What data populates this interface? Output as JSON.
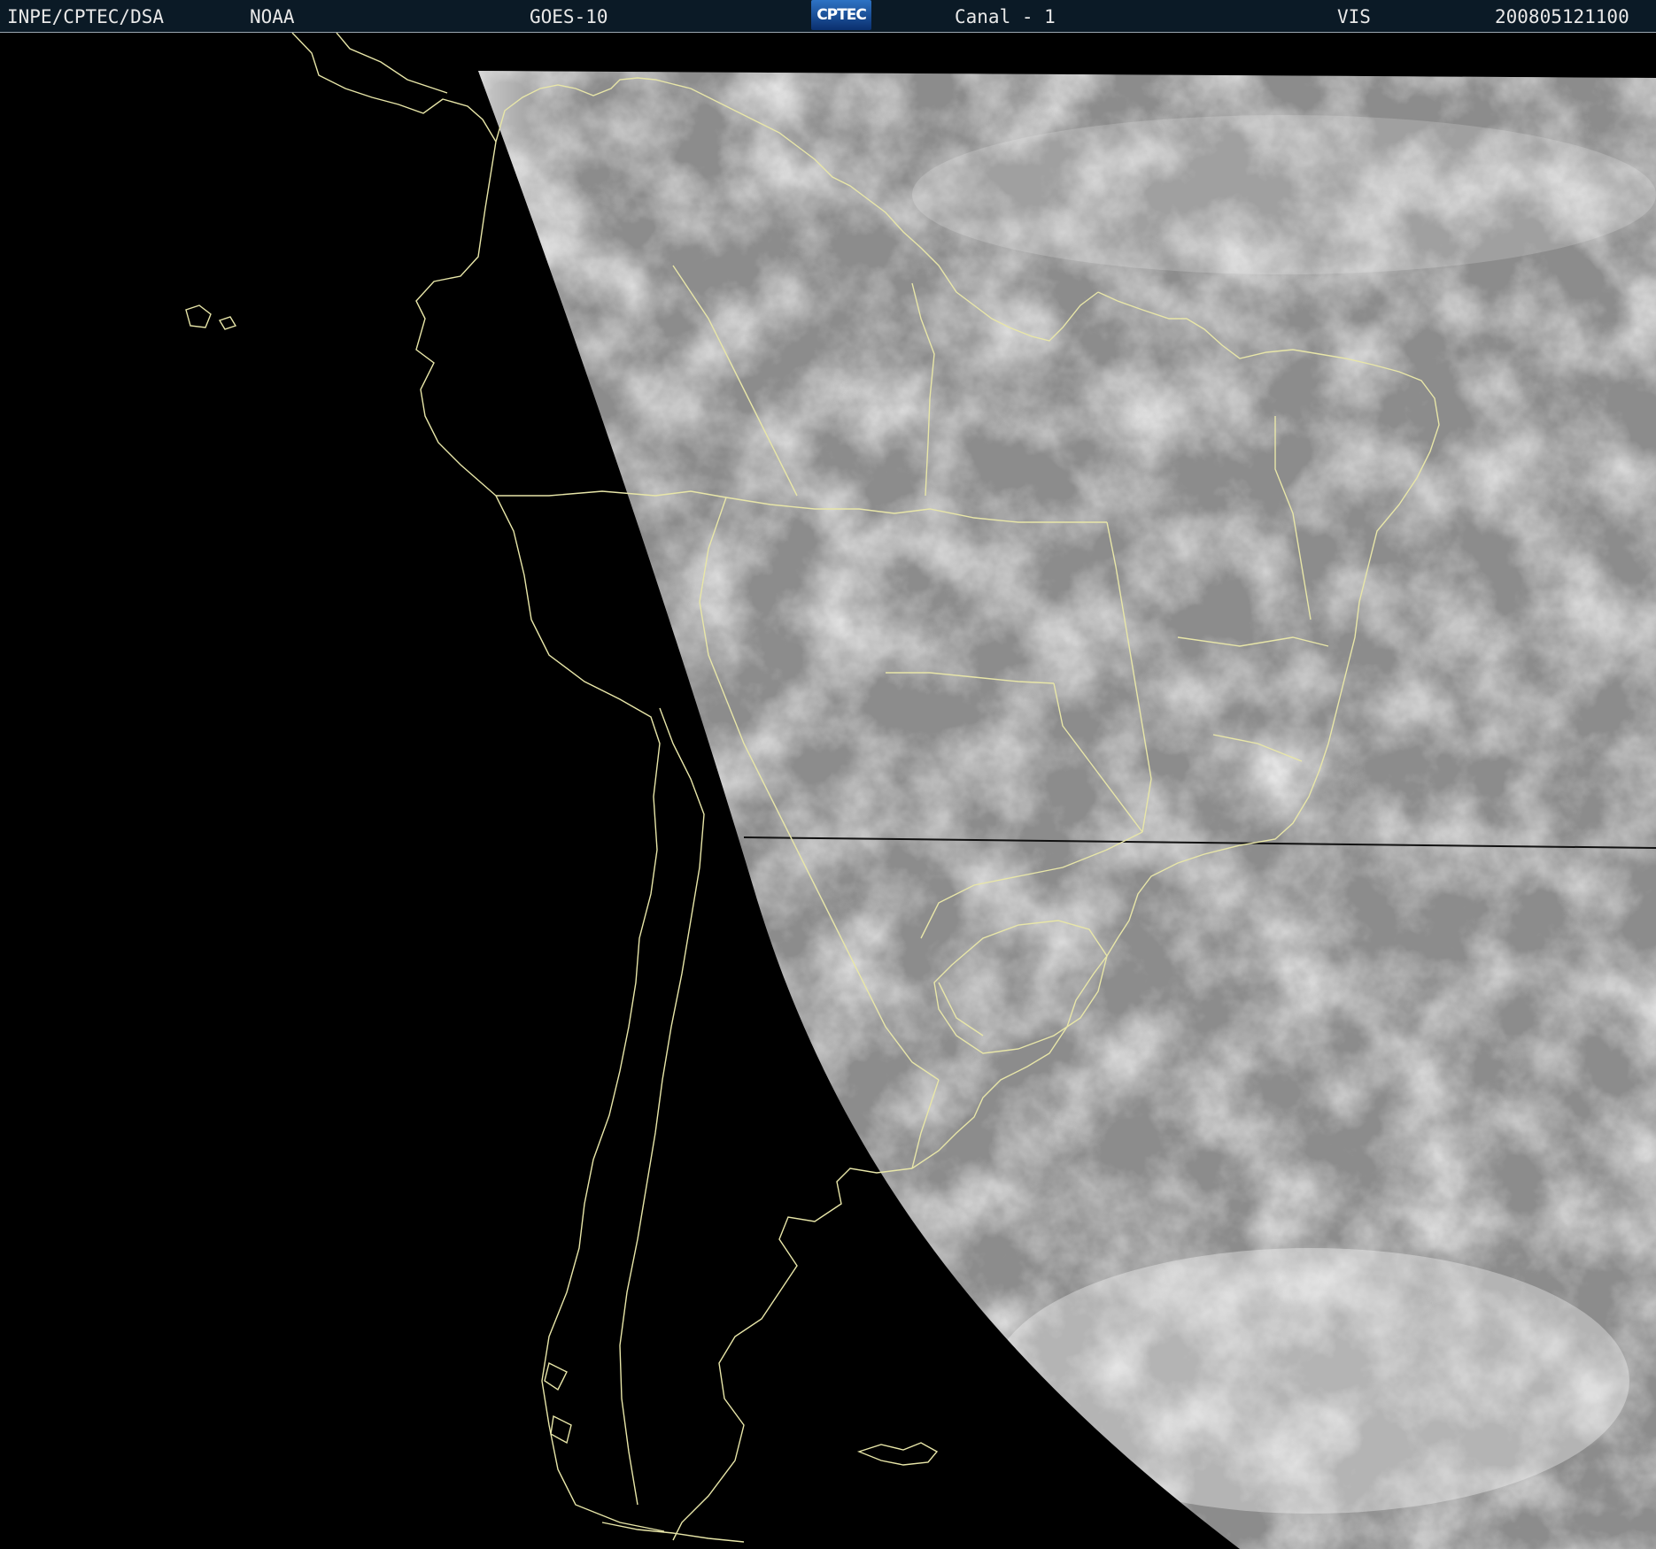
{
  "header": {
    "agency": "INPE/CPTEC/DSA",
    "source": "NOAA",
    "satellite": "GOES-10",
    "logo_text": "CPTEC",
    "channel": "Canal - 1",
    "band": "VIS",
    "datetime": "200805121100"
  },
  "colors": {
    "header_bg": "#0b1a26",
    "coastline": "#e8e6a8",
    "space": "#000000"
  }
}
